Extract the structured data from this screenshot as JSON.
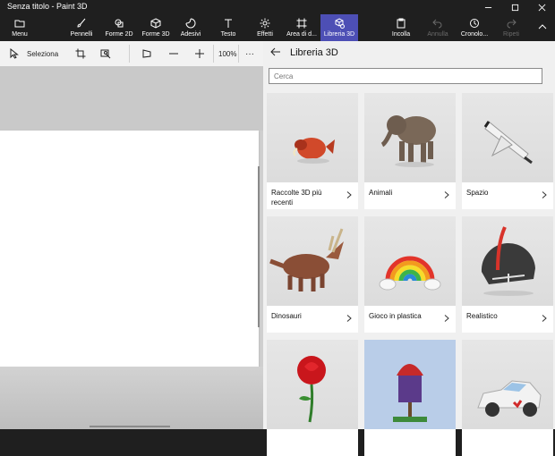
{
  "window": {
    "title": "Senza titolo - Paint 3D",
    "controls": [
      "minimize-icon",
      "maximize-icon",
      "close-icon"
    ]
  },
  "ribbon": {
    "items": [
      {
        "label": "Menu",
        "icon": "folder-icon"
      },
      {
        "label": "Pennelli",
        "icon": "brush-icon"
      },
      {
        "label": "Forme 2D",
        "icon": "shapes-2d-icon"
      },
      {
        "label": "Forme 3D",
        "icon": "cube-icon"
      },
      {
        "label": "Adesivi",
        "icon": "sticker-icon"
      },
      {
        "label": "Testo",
        "icon": "text-icon"
      },
      {
        "label": "Effetti",
        "icon": "effects-icon"
      },
      {
        "label": "Area di d...",
        "icon": "canvas-icon"
      },
      {
        "label": "Libreria 3D",
        "icon": "library-3d-icon",
        "active": true
      },
      {
        "label": "Incolla",
        "icon": "paste-icon"
      },
      {
        "label": "Annulla",
        "icon": "undo-icon",
        "disabled": true
      },
      {
        "label": "Cronolo...",
        "icon": "history-icon"
      },
      {
        "label": "Ripeti",
        "icon": "redo-icon",
        "disabled": true
      }
    ],
    "accent": "#4d4fb5"
  },
  "toolbar": {
    "select_label": "Seleziona",
    "zoom": "100%",
    "more": "···"
  },
  "panel": {
    "title": "Libreria 3D",
    "search_placeholder": "Cerca",
    "categories": [
      {
        "label": "Raccolte 3D più recenti",
        "icon": "fish-icon"
      },
      {
        "label": "Animali",
        "icon": "elephant-icon"
      },
      {
        "label": "Spazio",
        "icon": "space-shuttle-icon"
      },
      {
        "label": "Dinosauri",
        "icon": "dinosaur-icon"
      },
      {
        "label": "Gioco in plastica",
        "icon": "rainbow-icon"
      },
      {
        "label": "Realistico",
        "icon": "helmet-icon"
      },
      {
        "label": "",
        "icon": "rose-icon"
      },
      {
        "label": "",
        "icon": "house-icon"
      },
      {
        "label": "",
        "icon": "car-icon"
      }
    ]
  }
}
